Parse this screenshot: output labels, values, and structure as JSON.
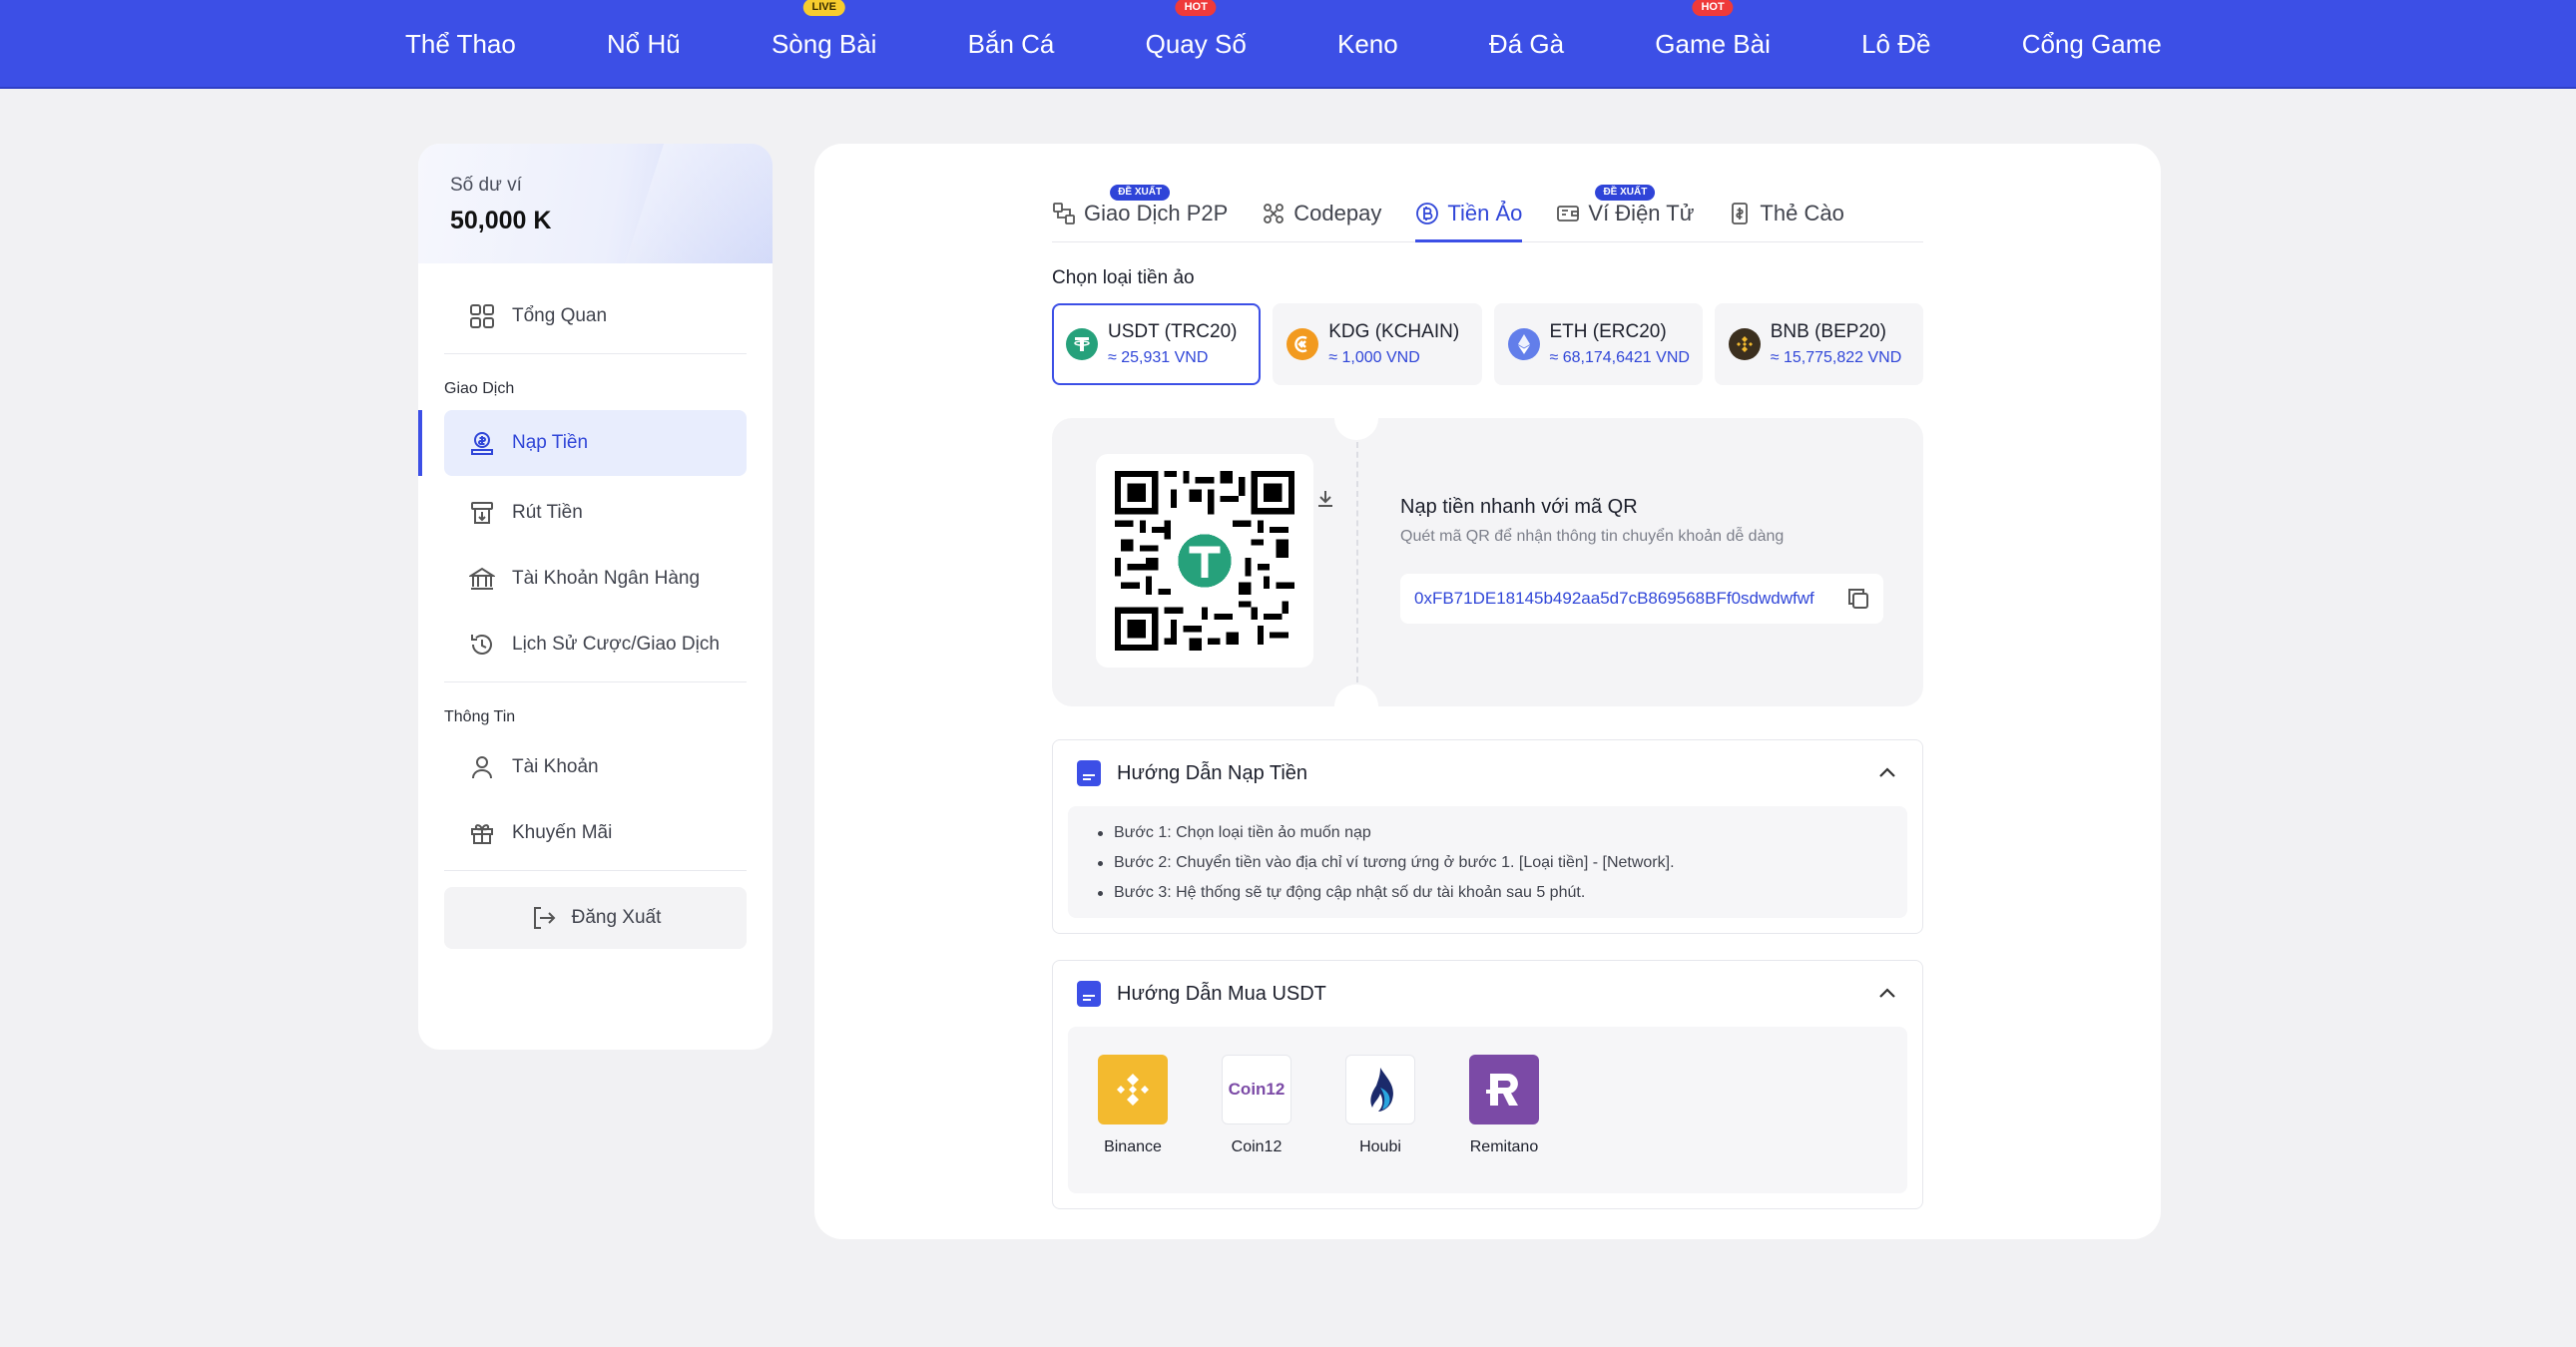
{
  "nav": {
    "items": [
      {
        "label": "Thể Thao",
        "badge": ""
      },
      {
        "label": "Nổ Hũ",
        "badge": ""
      },
      {
        "label": "Sòng Bài",
        "badge": "LIVE"
      },
      {
        "label": "Bắn Cá",
        "badge": ""
      },
      {
        "label": "Quay Số",
        "badge": "HOT"
      },
      {
        "label": "Keno",
        "badge": ""
      },
      {
        "label": "Đá Gà",
        "badge": ""
      },
      {
        "label": "Game Bài",
        "badge": "HOT"
      },
      {
        "label": "Lô Đề",
        "badge": ""
      },
      {
        "label": "Cổng Game",
        "badge": ""
      }
    ]
  },
  "sidebar": {
    "wallet_label": "Số dư ví",
    "wallet_value": "50,000 K",
    "overview": "Tổng Quan",
    "section_transactions": "Giao Dịch",
    "deposit": "Nạp Tiền",
    "withdraw": "Rút Tiền",
    "bank_account": "Tài Khoản Ngân Hàng",
    "history": "Lịch Sử Cược/Giao Dịch",
    "section_info": "Thông Tin",
    "account": "Tài Khoản",
    "promotions": "Khuyến Mãi",
    "logout": "Đăng Xuất"
  },
  "tabs": [
    {
      "label": "Giao Dịch P2P",
      "badge": "ĐỀ XUẤT"
    },
    {
      "label": "Codepay",
      "badge": ""
    },
    {
      "label": "Tiền Ảo",
      "badge": ""
    },
    {
      "label": "Ví Điện Tử",
      "badge": "ĐỀ XUẤT"
    },
    {
      "label": "Thẻ Cào",
      "badge": ""
    }
  ],
  "crypto": {
    "choose_label": "Chọn loại tiền ảo",
    "coins": [
      {
        "name": "USDT (TRC20)",
        "rate": "≈ 25,931 VND",
        "color": "#26a17b"
      },
      {
        "name": "KDG (KCHAIN)",
        "rate": "≈ 1,000 VND",
        "color": "#f29a1f"
      },
      {
        "name": "ETH (ERC20)",
        "rate": "≈ 68,174,6421 VND",
        "color": "#627eea"
      },
      {
        "name": "BNB (BEP20)",
        "rate": "≈ 15,775,822 VND",
        "color": "#3b2f1e"
      }
    ]
  },
  "qr": {
    "title": "Nạp tiền nhanh với mã QR",
    "subtitle": "Quét mã QR để nhận thông tin chuyển khoản dễ dàng",
    "address": "0xFB71DE18145b492aa5d7cB869568BFf0sdwdwfwf"
  },
  "guide": {
    "title": "Hướng Dẫn Nạp Tiền",
    "steps": [
      "Bước 1: Chọn loại tiền ảo muốn nạp",
      "Bước 2: Chuyển tiền vào địa chỉ ví tương ứng ở bước 1. [Loại tiền] - [Network].",
      "Bước 3: Hệ thống sẽ tự động cập nhật số dư tài khoản sau 5 phút."
    ]
  },
  "buy": {
    "title": "Hướng Dẫn Mua USDT",
    "exchanges": [
      {
        "name": "Binance",
        "color": "#f3ba2f"
      },
      {
        "name": "Coin12",
        "color": "#ffffff"
      },
      {
        "name": "Houbi",
        "color": "#ffffff"
      },
      {
        "name": "Remitano",
        "color": "#7b4aa6"
      }
    ],
    "coin12_logo_text": "Coin12"
  },
  "colors": {
    "accent": "#3c4fe6",
    "accent_text": "#3046d8"
  }
}
